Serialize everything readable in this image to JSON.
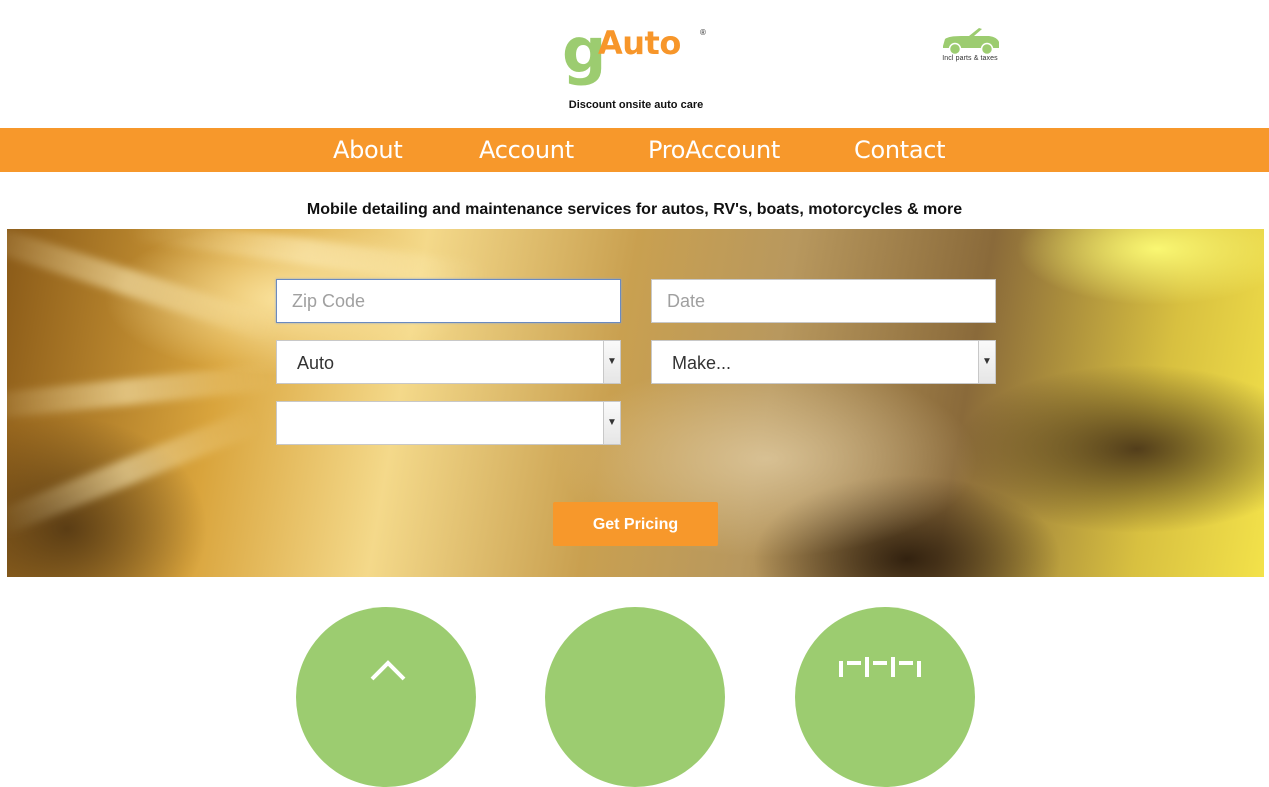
{
  "brand": {
    "logo_g": "g",
    "logo_auto": "Auto",
    "logo_reg": "®",
    "tagline": "Discount onsite auto care",
    "logo_colors": {
      "g": "#9ccc70",
      "auto": "#f7962a"
    }
  },
  "badge": {
    "icon": "convertible-car-icon",
    "note": "Incl parts & taxes"
  },
  "nav": {
    "background": "#f7982b",
    "items": [
      {
        "label": "About"
      },
      {
        "label": "Account"
      },
      {
        "label": "ProAccount"
      },
      {
        "label": "Contact"
      }
    ]
  },
  "subheading": "Mobile detailing and maintenance services for autos, RV's, boats, motorcycles & more",
  "form": {
    "zip": {
      "placeholder": "Zip Code",
      "value": ""
    },
    "date": {
      "placeholder": "Date",
      "value": ""
    },
    "vehicle_type": {
      "selected": "Auto"
    },
    "make": {
      "selected": "Make..."
    },
    "model": {
      "selected": ""
    },
    "submit_label": "Get Pricing"
  },
  "features": [
    {
      "icon": "home-icon"
    },
    {
      "icon": "service-icon"
    },
    {
      "icon": "toolbox-icon"
    }
  ],
  "colors": {
    "accent_orange": "#f7982b",
    "accent_green": "#9ccc70"
  }
}
